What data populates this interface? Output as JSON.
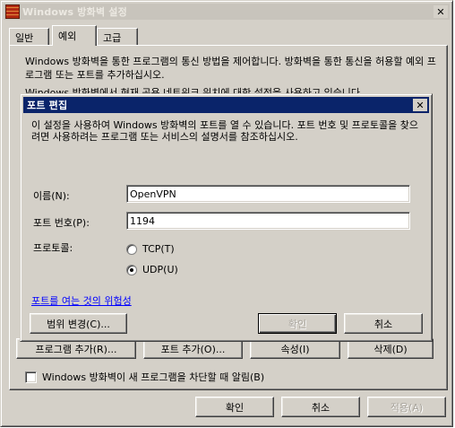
{
  "main_window": {
    "title": "Windows 방화벽 설정",
    "close_glyph": "✕",
    "tabs": [
      "일반",
      "예외",
      "고급"
    ],
    "selected_tab": "예외",
    "intro": "Windows 방화벽을 통한 프로그램의 통신 방법을 제어합니다. 방화벽을 통한 통신을 허용할 예외 프로그램 또는 포트를 추가하십시오.",
    "intro_partial": "Windows 방화벽에서 현재 공용 네트워크 위치에 대한 설정을 사용하고 있습니다.",
    "buttons": {
      "add_program": "프로그램 추가(R)...",
      "add_port": "포트 추가(O)...",
      "properties": "속성(I)",
      "delete": "삭제(D)"
    },
    "notify_checkbox": "Windows 방화벽이 새 프로그램을 차단할 때 알림(B)",
    "notify_checked": false,
    "footer": {
      "ok": "확인",
      "cancel": "취소",
      "apply": "적용(A)"
    }
  },
  "port_dialog": {
    "title": "포트 편집",
    "close_glyph": "✕",
    "description": "이 설정을 사용하여 Windows 방화벽의 포트를 열 수 있습니다. 포트 번호 및 프로토콜을 찾으려면 사용하려는 프로그램 또는 서비스의 설명서를 참조하십시오.",
    "name_label": "이름(N):",
    "name_value": "OpenVPN",
    "port_label": "포트 번호(P):",
    "port_value": "1194",
    "protocol_label": "프로토콜:",
    "tcp_label": "TCP(T)",
    "udp_label": "UDP(U)",
    "selected_protocol": "UDP",
    "risk_link": "포트를 여는 것의 위험성",
    "scope_button": "범위 변경(C)...",
    "ok": "확인",
    "cancel": "취소"
  },
  "colors": {
    "face": "#d4d0c8",
    "active_title": "#0a246a",
    "inactive_title": "#c8c4bc",
    "link": "#0000ff"
  },
  "icons": [
    "firewall-icon",
    "close-icon",
    "radio-icon",
    "checkbox-icon"
  ]
}
